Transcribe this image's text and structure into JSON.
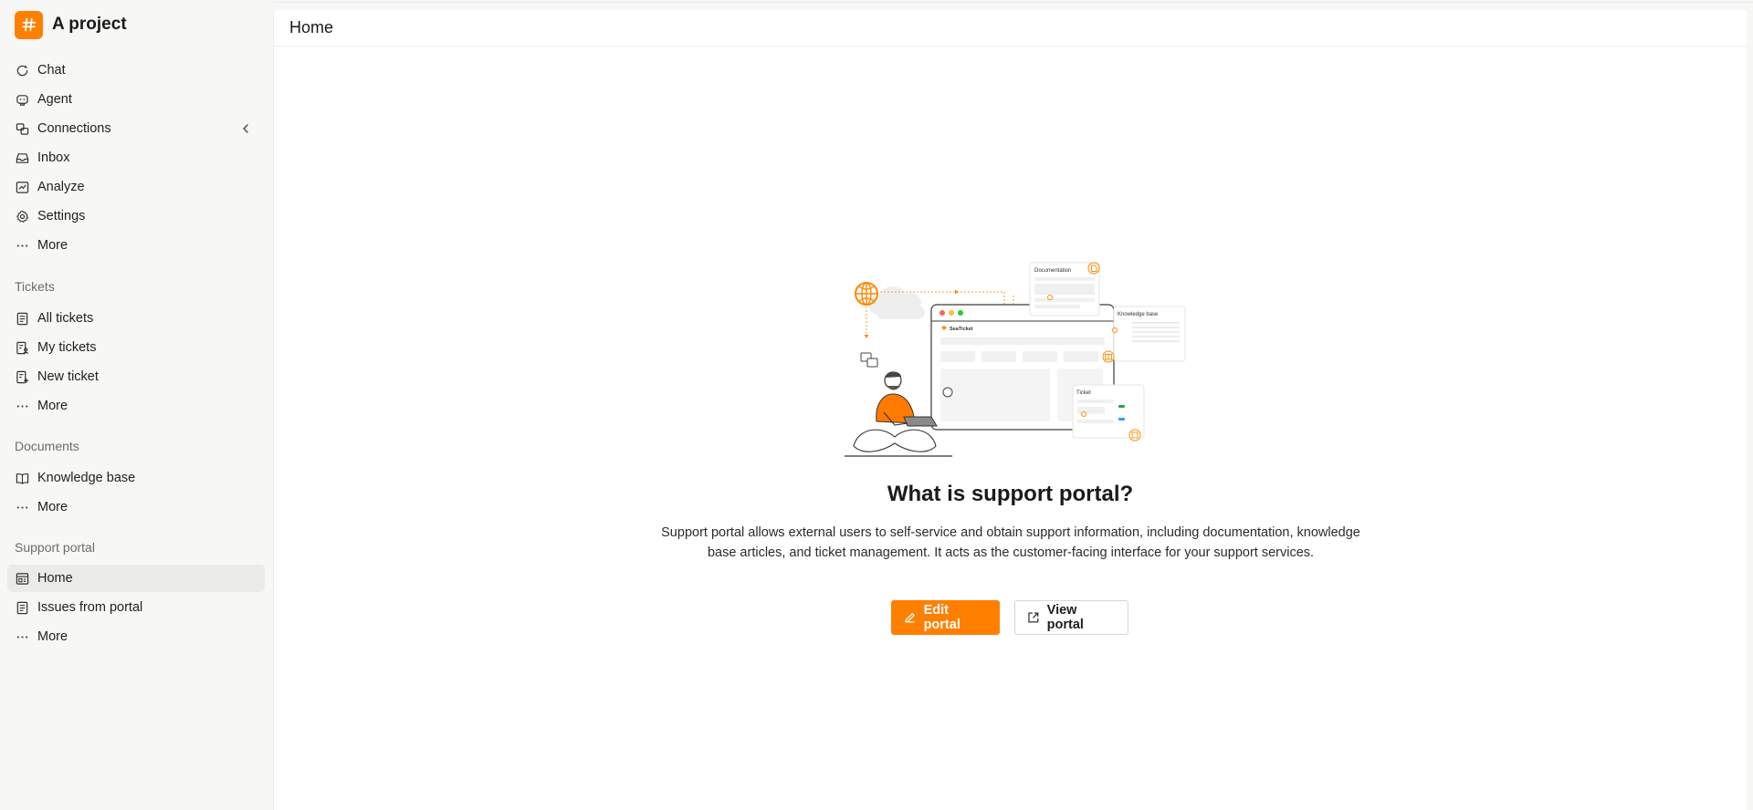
{
  "brand": {
    "title": "A project",
    "logo_glyph": "#",
    "color": "#ff7f00"
  },
  "sidebar": {
    "main_items": [
      {
        "label": "Chat",
        "icon": "chat-icon"
      },
      {
        "label": "Agent",
        "icon": "agent-icon"
      },
      {
        "label": "Connections",
        "icon": "connections-icon"
      },
      {
        "label": "Inbox",
        "icon": "inbox-icon"
      },
      {
        "label": "Analyze",
        "icon": "analyze-icon"
      },
      {
        "label": "Settings",
        "icon": "settings-icon"
      },
      {
        "label": "More",
        "icon": "more-icon"
      }
    ],
    "tickets": {
      "label": "Tickets",
      "items": [
        {
          "label": "All tickets",
          "icon": "ticket-list-icon"
        },
        {
          "label": "My tickets",
          "icon": "my-tickets-icon"
        },
        {
          "label": "New ticket",
          "icon": "new-ticket-icon"
        },
        {
          "label": "More",
          "icon": "more-icon"
        }
      ]
    },
    "documents": {
      "label": "Documents",
      "items": [
        {
          "label": "Knowledge base",
          "icon": "book-icon"
        },
        {
          "label": "More",
          "icon": "more-icon"
        }
      ]
    },
    "support_portal": {
      "label": "Support portal",
      "items": [
        {
          "label": "Home",
          "icon": "portal-home-icon",
          "active": true
        },
        {
          "label": "Issues from portal",
          "icon": "issues-icon"
        },
        {
          "label": "More",
          "icon": "more-icon"
        }
      ]
    }
  },
  "header": {
    "title": "Home"
  },
  "hero": {
    "title": "What is support portal?",
    "description": "Support portal allows external users to self-service and obtain support information, including documentation, knowledge base articles, and ticket management. It acts as the customer-facing interface for your support services.",
    "edit_label": "Edit portal",
    "view_label": "View portal"
  },
  "illustration": {
    "documentation_label": "Documentation",
    "knowledge_label": "Knowledge base",
    "ticket_label": "Ticket",
    "brand_label": "SeaTicket"
  }
}
